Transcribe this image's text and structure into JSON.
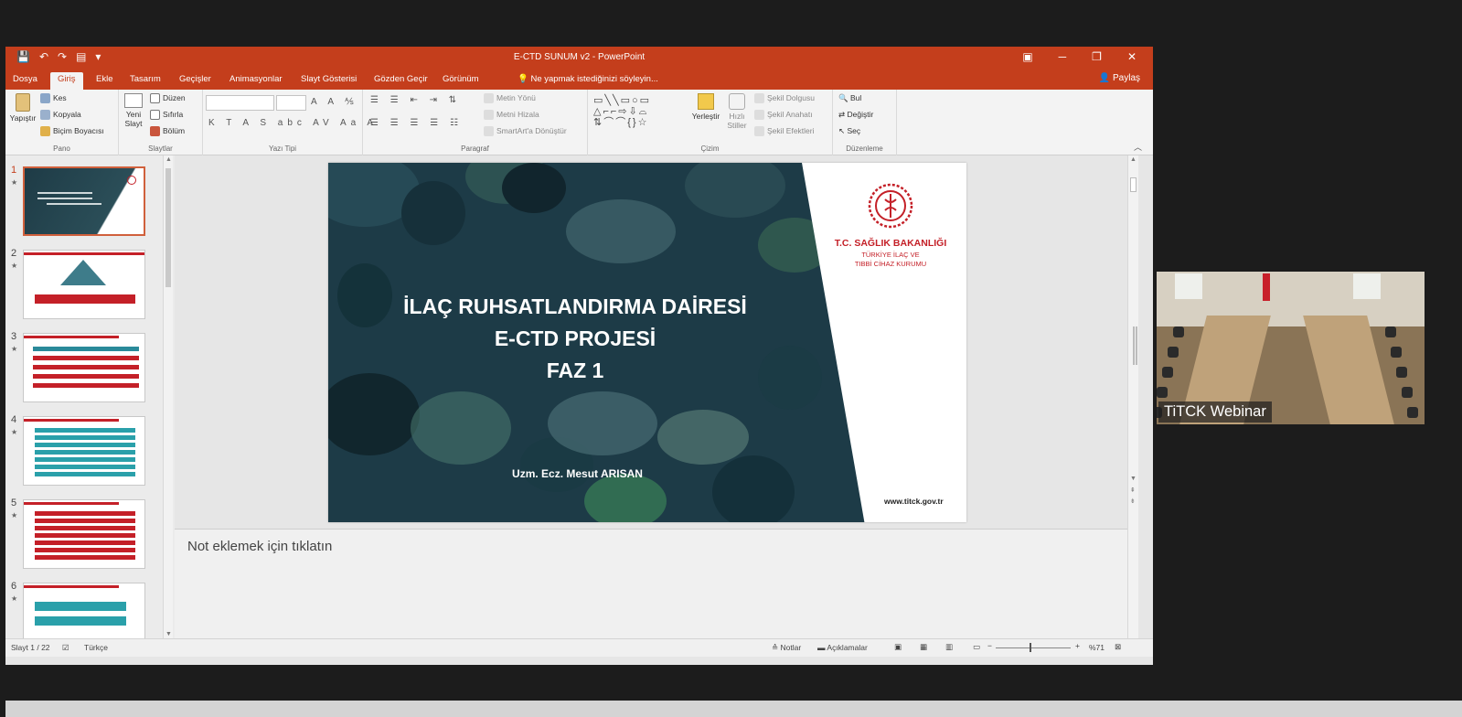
{
  "window": {
    "title": "E-CTD SUNUM v2 - PowerPoint",
    "quick_access": [
      "💾",
      "↶",
      "↷",
      "▤",
      "▾"
    ],
    "controls": [
      "▣",
      "─",
      "❐",
      "✕"
    ]
  },
  "tabs": [
    "Dosya",
    "Giriş",
    "Ekle",
    "Tasarım",
    "Geçişler",
    "Animasyonlar",
    "Slayt Gösterisi",
    "Gözden Geçir",
    "Görünüm"
  ],
  "tell_me": "Ne yapmak istediğinizi söyleyin...",
  "share": "Paylaş",
  "ribbon": {
    "pano": {
      "paste": "Yapıştır",
      "cut": "Kes",
      "copy": "Kopyala",
      "format_painter": "Biçim Boyacısı",
      "caption": "Pano"
    },
    "slaytlar": {
      "new_slide_1": "Yeni",
      "new_slide_2": "Slayt",
      "layout": "Düzen",
      "reset": "Sıfırla",
      "section": "Bölüm",
      "caption": "Slaytlar"
    },
    "yazi_tipi": {
      "caption": "Yazı Tipi"
    },
    "paragraf": {
      "text_direction": "Metin Yönü",
      "align_text": "Metni Hizala",
      "smartart": "SmartArt'a Dönüştür",
      "caption": "Paragraf"
    },
    "cizim": {
      "arrange": "Yerleştir",
      "quick_styles_1": "Hızlı",
      "quick_styles_2": "Stiller",
      "shape_fill": "Şekil Dolgusu",
      "shape_outline": "Şekil Anahatı",
      "shape_effects": "Şekil Efektleri",
      "caption": "Çizim"
    },
    "duzenleme": {
      "find": "Bul",
      "replace": "Değiştir",
      "select": "Seç",
      "caption": "Düzenleme"
    }
  },
  "thumbnails": [
    {
      "num": "1",
      "star": "★"
    },
    {
      "num": "2",
      "star": "★"
    },
    {
      "num": "3",
      "star": "★"
    },
    {
      "num": "4",
      "star": "★"
    },
    {
      "num": "5",
      "star": "★"
    },
    {
      "num": "6",
      "star": "★"
    }
  ],
  "slide": {
    "title_line1": "İLAÇ RUHSATLANDIRMA DAİRESİ",
    "title_line2": "E-CTD PROJESİ",
    "title_line3": "FAZ 1",
    "presenter": "Uzm. Ecz. Mesut ARISAN",
    "ministry_name": "T.C. SAĞLIK BAKANLIĞI",
    "ministry_sub_1": "TÜRKİYE İLAÇ VE",
    "ministry_sub_2": "TIBBİ CİHAZ KURUMU",
    "url": "www.titck.gov.tr"
  },
  "notes_placeholder": "Not eklemek için tıklatın",
  "status": {
    "slide_counter": "Slayt 1 / 22",
    "language": "Türkçe",
    "notes": "Notlar",
    "comments": "Açıklamalar",
    "zoom": "%71"
  },
  "video": {
    "label": "TiTCK Webinar"
  },
  "colors": {
    "accent": "#c43e1c",
    "slide_bg": "#1d3b47",
    "ministry_red": "#c42028"
  }
}
